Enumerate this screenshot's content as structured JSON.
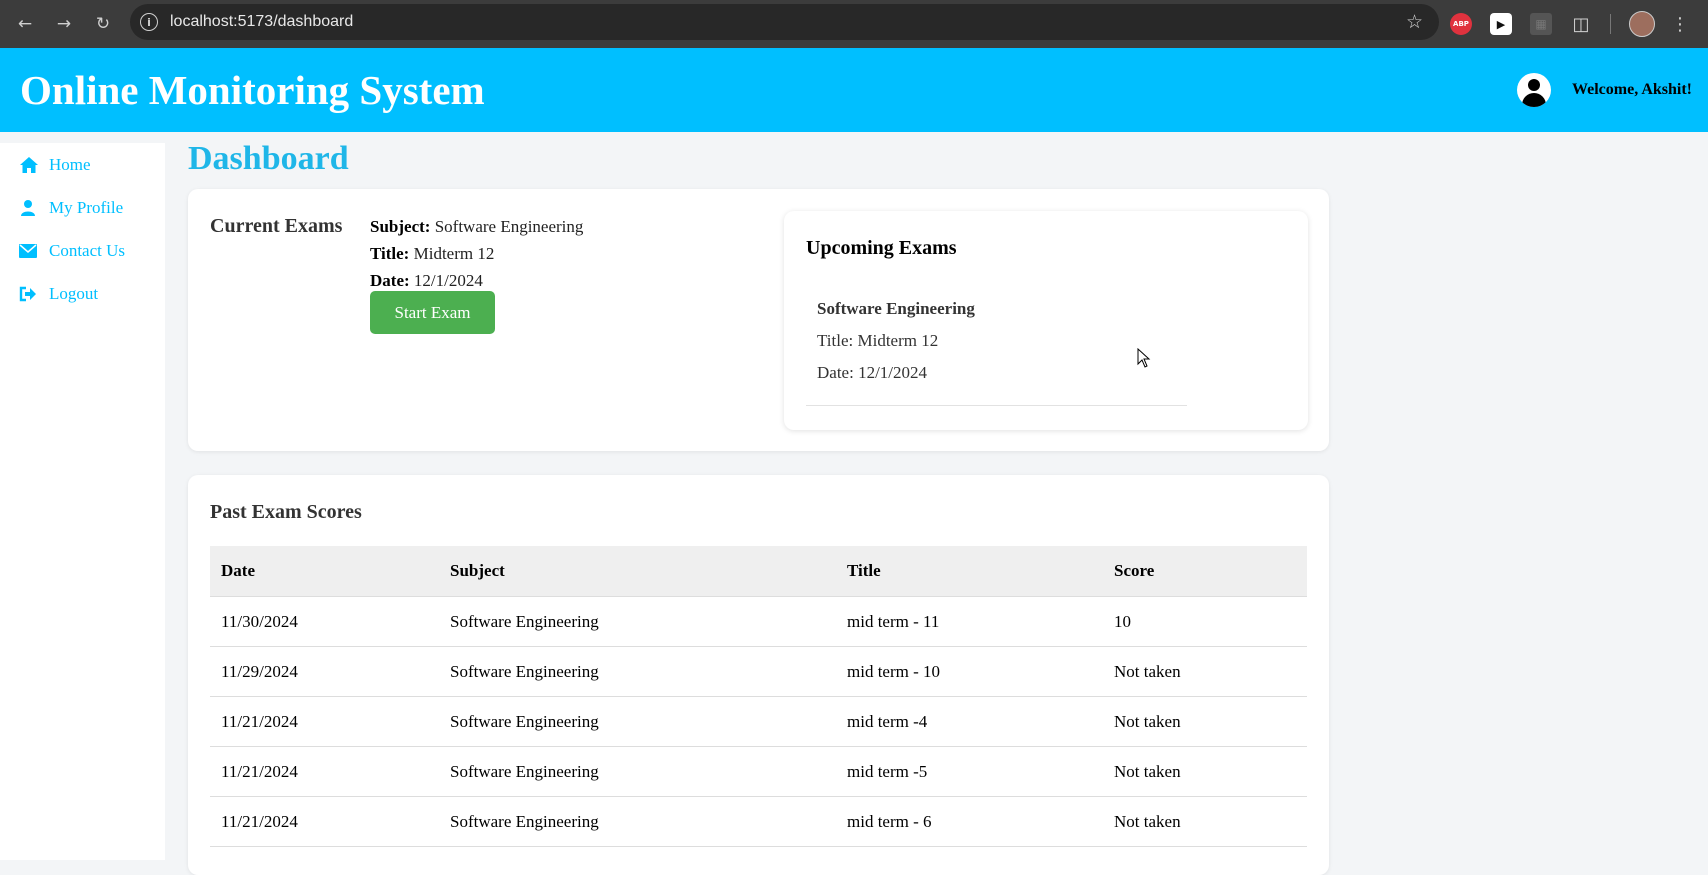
{
  "browser": {
    "url": "localhost:5173/dashboard",
    "icons": [
      "back-arrow-icon",
      "forward-arrow-icon",
      "reload-icon",
      "info-icon",
      "star-icon",
      "adblock-icon",
      "play-extension-icon",
      "extension-icon",
      "puzzle-icon",
      "profile-avatar",
      "kebab-menu-icon"
    ]
  },
  "header": {
    "title": "Online Monitoring System",
    "welcome": "Welcome, Akshit!"
  },
  "sidebar": {
    "items": [
      {
        "label": "Home",
        "icon": "home-icon"
      },
      {
        "label": "My Profile",
        "icon": "user-icon"
      },
      {
        "label": "Contact Us",
        "icon": "envelope-icon"
      },
      {
        "label": "Logout",
        "icon": "sign-out-icon"
      }
    ]
  },
  "main": {
    "title": "Dashboard",
    "current": {
      "heading": "Current Exams",
      "subject_label": "Subject:",
      "subject": "Software Engineering",
      "title_label": "Title:",
      "title": "Midterm 12",
      "date_label": "Date:",
      "date": "12/1/2024",
      "start_button": "Start Exam"
    },
    "upcoming": {
      "heading": "Upcoming Exams",
      "subject": "Software Engineering",
      "title": "Title: Midterm 12",
      "date": "Date: 12/1/2024"
    },
    "past": {
      "heading": "Past Exam Scores",
      "columns": [
        "Date",
        "Subject",
        "Title",
        "Score"
      ],
      "rows": [
        [
          "11/30/2024",
          "Software Engineering",
          "mid term - 11",
          "10"
        ],
        [
          "11/29/2024",
          "Software Engineering",
          "mid term - 10",
          "Not taken"
        ],
        [
          "11/21/2024",
          "Software Engineering",
          "mid term -4",
          "Not taken"
        ],
        [
          "11/21/2024",
          "Software Engineering",
          "mid term -5",
          "Not taken"
        ],
        [
          "11/21/2024",
          "Software Engineering",
          "mid term - 6",
          "Not taken"
        ]
      ]
    }
  },
  "colors": {
    "header_bg": "#00bfff",
    "accent": "#00bfff",
    "start_button": "#4caf50",
    "page_bg": "#f3f5f7"
  }
}
